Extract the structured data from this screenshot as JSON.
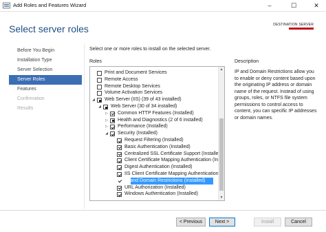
{
  "window": {
    "title": "Add Roles and Features Wizard",
    "minimize_glyph": "–",
    "maximize_glyph": "☐",
    "close_glyph": "✕"
  },
  "header": {
    "page_title": "Select server roles",
    "destination_label": "DESTINATION SERVER",
    "destination_value_color": "#c0141c"
  },
  "nav": {
    "items": [
      {
        "label": "Before You Begin",
        "state": "normal"
      },
      {
        "label": "Installation Type",
        "state": "normal"
      },
      {
        "label": "Server Selection",
        "state": "normal"
      },
      {
        "label": "Server Roles",
        "state": "selected"
      },
      {
        "label": "Features",
        "state": "normal"
      },
      {
        "label": "Confirmation",
        "state": "disabled"
      },
      {
        "label": "Results",
        "state": "disabled"
      }
    ],
    "selected_color": "#3c6eb4"
  },
  "main": {
    "instruction": "Select one or more roles to install on the selected server.",
    "roles_label": "Roles",
    "description_label": "Description",
    "description_text": "IP and Domain Restrictions allow you to enable or deny content based upon the originating IP address or domain name of the request. Instead of using groups, roles, or NTFS file system permissions to control access to content, you can specific IP addresses or domain names."
  },
  "roles_tree": [
    {
      "label": "Print and Document Services",
      "state": "unchecked",
      "expander": "",
      "selected": false
    },
    {
      "label": "Remote Access",
      "state": "unchecked",
      "expander": "",
      "selected": false
    },
    {
      "label": "Remote Desktop Services",
      "state": "unchecked",
      "expander": "",
      "selected": false
    },
    {
      "label": "Volume Activation Services",
      "state": "unchecked",
      "expander": "",
      "selected": false
    },
    {
      "label": "Web Server (IIS) (39 of 43 installed)",
      "state": "partial",
      "expander": "◢",
      "selected": false
    },
    {
      "label": "Web Server (30 of 34 installed)",
      "state": "partial",
      "expander": "◢",
      "selected": false
    },
    {
      "label": "Common HTTP Features (Installed)",
      "state": "checked",
      "expander": "▷",
      "selected": false
    },
    {
      "label": "Health and Diagnostics (2 of 6 installed)",
      "state": "partial",
      "expander": "▷",
      "selected": false
    },
    {
      "label": "Performance (Installed)",
      "state": "checked",
      "expander": "▷",
      "selected": false
    },
    {
      "label": "Security (Installed)",
      "state": "checked",
      "expander": "◢",
      "selected": false
    },
    {
      "label": "Request Filtering (Installed)",
      "state": "checked",
      "expander": "",
      "selected": false
    },
    {
      "label": "Basic Authentication (Installed)",
      "state": "checked",
      "expander": "",
      "selected": false
    },
    {
      "label": "Centralized SSL Certificate Support (Installed)",
      "state": "checked",
      "expander": "",
      "selected": false
    },
    {
      "label": "Client Certificate Mapping Authentication (Installed)",
      "state": "checked",
      "expander": "",
      "selected": false
    },
    {
      "label": "Digest Authentication (Installed)",
      "state": "checked",
      "expander": "",
      "selected": false
    },
    {
      "label": "IIS Client Certificate Mapping Authentication (Installed)",
      "state": "checked",
      "expander": "",
      "selected": false
    },
    {
      "label": "IP and Domain Restrictions (Installed)",
      "state": "checked",
      "expander": "",
      "selected": true
    },
    {
      "label": "URL Authorization (Installed)",
      "state": "checked",
      "expander": "",
      "selected": false
    },
    {
      "label": "Windows Authentication (Installed)",
      "state": "checked",
      "expander": "",
      "selected": false
    }
  ],
  "scrollbar": {
    "up_glyph": "▲",
    "down_glyph": "▼"
  },
  "footer": {
    "previous_label": "< Previous",
    "next_label": "Next >",
    "install_label": "Install",
    "cancel_label": "Cancel"
  }
}
